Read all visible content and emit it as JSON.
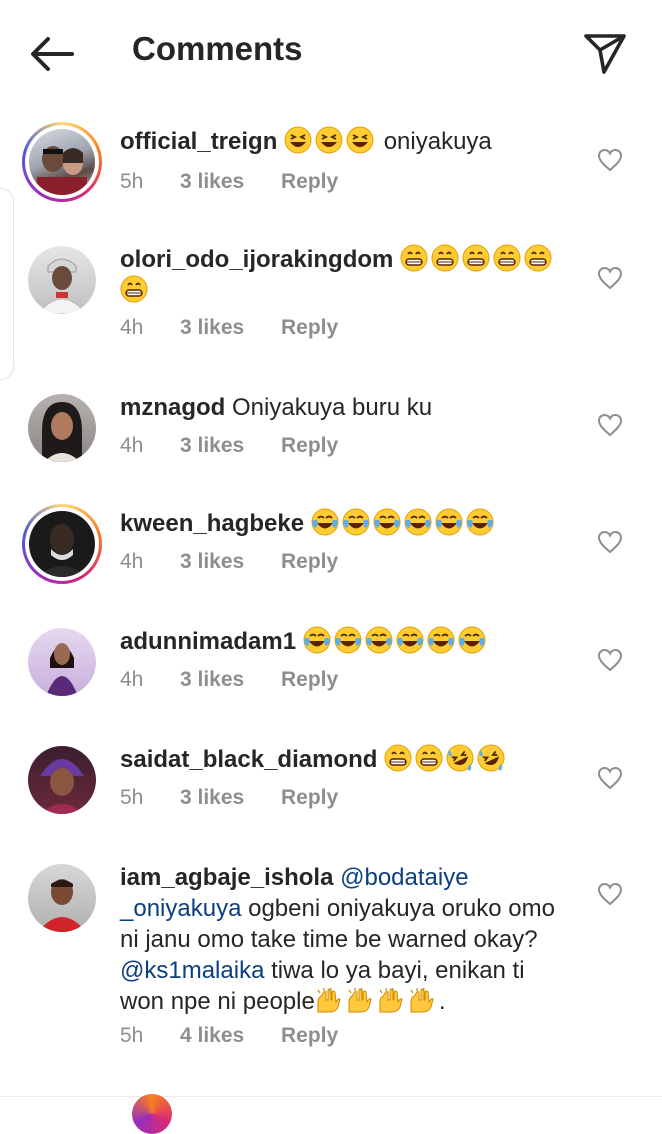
{
  "header": {
    "title": "Comments",
    "back_icon": "arrow-left-icon",
    "send_icon": "paper-plane-icon"
  },
  "colors": {
    "text": "#262626",
    "meta": "#8e8e8e",
    "mention": "#0b3f80",
    "story_ring": [
      "#feda75",
      "#fa7e1e",
      "#d62976",
      "#962fbf",
      "#4f5bd5"
    ]
  },
  "comments": [
    {
      "username": "official_treign",
      "emojis": [
        "squint-laugh",
        "squint-laugh",
        "squint-laugh"
      ],
      "text": " oniyakuya",
      "time": "5h",
      "likes": "3 likes",
      "reply": "Reply",
      "story_ring": true
    },
    {
      "username": "olori_odo_ijorakingdom",
      "emojis": [
        "grin",
        "grin",
        "grin",
        "grin",
        "grin",
        "grin"
      ],
      "text": "",
      "time": "4h",
      "likes": "3 likes",
      "reply": "Reply",
      "story_ring": false
    },
    {
      "username": "mznagod",
      "emojis": [],
      "text": "Oniyakuya buru ku",
      "time": "4h",
      "likes": "3 likes",
      "reply": "Reply",
      "story_ring": false
    },
    {
      "username": "kween_hagbeke",
      "emojis": [
        "tears-of-joy",
        "tears-of-joy",
        "tears-of-joy",
        "tears-of-joy",
        "tears-of-joy",
        "tears-of-joy"
      ],
      "text": "",
      "time": "4h",
      "likes": "3 likes",
      "reply": "Reply",
      "story_ring": true
    },
    {
      "username": "adunnimadam1",
      "emojis": [
        "tears-of-joy",
        "tears-of-joy",
        "tears-of-joy",
        "tears-of-joy",
        "tears-of-joy",
        "tears-of-joy"
      ],
      "text": "",
      "time": "4h",
      "likes": "3 likes",
      "reply": "Reply",
      "story_ring": false
    },
    {
      "username": "saidat_black_diamond",
      "emojis": [
        "grin",
        "grin",
        "rofl",
        "rofl"
      ],
      "text": "",
      "time": "5h",
      "likes": "3 likes",
      "reply": "Reply",
      "story_ring": false
    },
    {
      "username": "iam_agbaje_ishola",
      "mention1": "@bodataiye_oniyakuya",
      "mention1_line1": "@bodataiye",
      "mention1_line2": "_oniyakuya",
      "text1": " ogbeni oniyakuya oruko omo ni janu omo take time be warned okay? ",
      "mention2": "@ks1malaika",
      "text2": " tiwa lo ya bayi, enikan ti won npe ni people",
      "emojis_end": [
        "raising-hands",
        "raising-hands",
        "raising-hands",
        "raising-hands"
      ],
      "text_end": ".",
      "time": "5h",
      "likes": "4 likes",
      "reply": "Reply",
      "story_ring": false
    }
  ]
}
